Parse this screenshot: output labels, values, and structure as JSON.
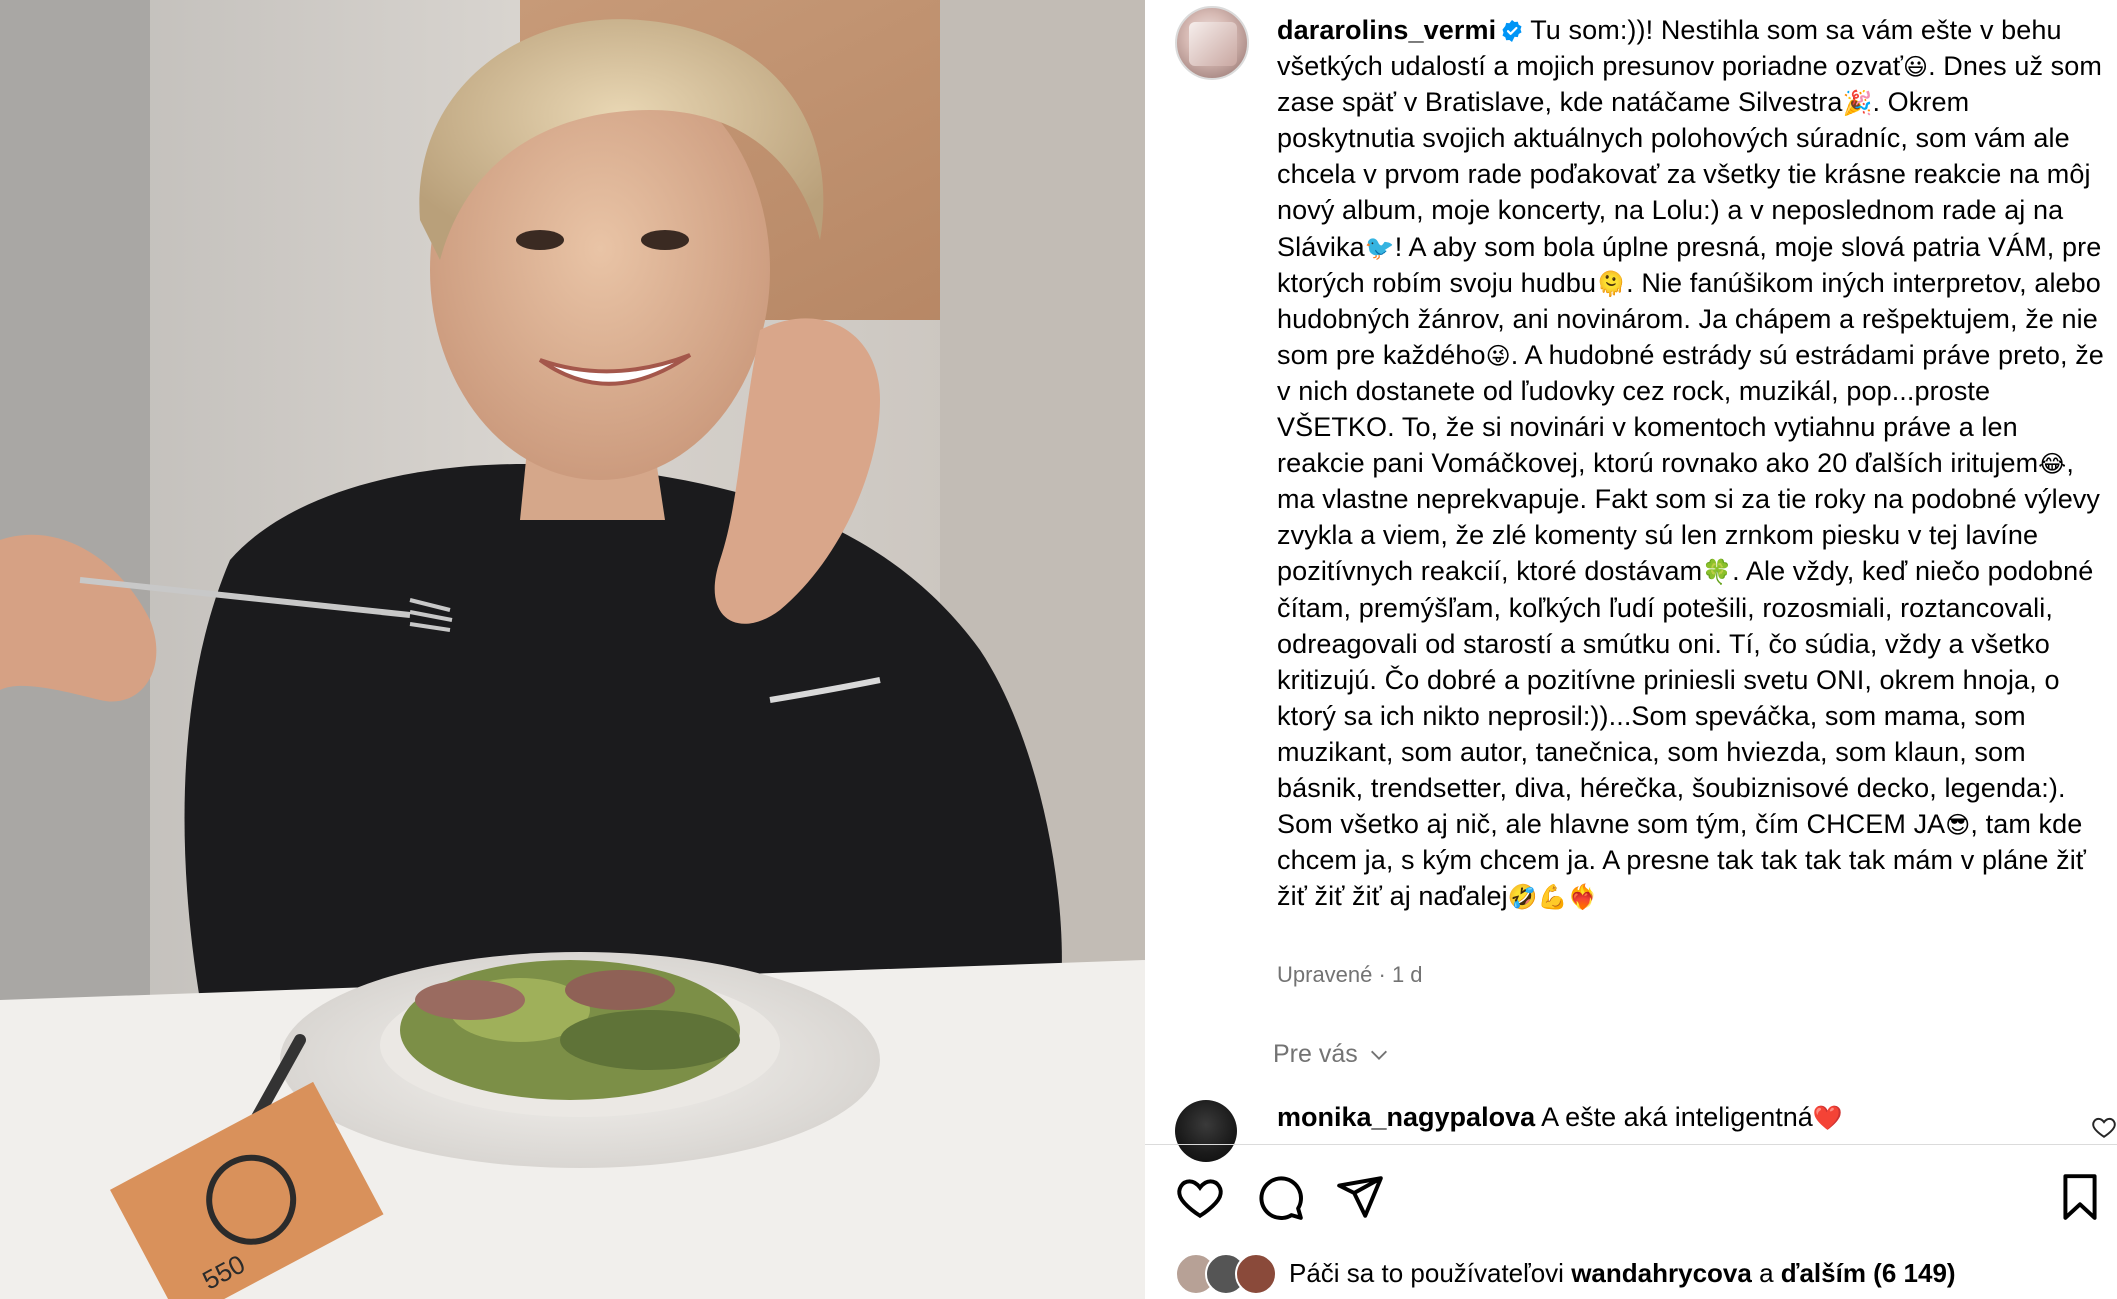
{
  "post": {
    "username": "dararolins_vermi",
    "caption": [
      {
        "t": "Tu som:))! Nestihla som sa vám ešte v behu všetkých udalostí a mojich presunov poriadne ozvať"
      },
      {
        "e": "😃"
      },
      {
        "t": ". Dnes už som zase späť v Bratislave, kde natáčame Silvestra"
      },
      {
        "e": "🎉"
      },
      {
        "t": ". Okrem poskytnutia svojich aktuálnych polohových súradníc, som vám ale chcela v prvom rade poďakovať za všetky tie krásne reakcie na môj nový album, moje koncerty, na Lolu:) a v neposlednom rade aj na Slávika"
      },
      {
        "e": "🐦"
      },
      {
        "t": "! A aby som bola úplne presná, moje slová patria VÁM, pre ktorých robím svoju hudbu"
      },
      {
        "e": "🫠"
      },
      {
        "t": ". Nie fanúšikom iných interpretov, alebo hudobných žánrov, ani novinárom. Ja chápem a rešpektujem, že nie som pre každého"
      },
      {
        "e": "😜"
      },
      {
        "t": ". A hudobné estrády sú estrádami práve preto, že v nich dostanete od ľudovky cez rock, muzikál, pop...proste VŠETKO. To, že si novinári v komentoch vytiahnu práve a len reakcie pani Vomáčkovej, ktorú rovnako ako 20 ďalších iritujem"
      },
      {
        "e": "😂"
      },
      {
        "t": ", ma vlastne neprekvapuje. Fakt som si za tie roky na podobné výlevy zvykla a viem, že zlé komenty sú len zrnkom piesku v tej lavíne pozitívnych reakcií, ktoré dostávam"
      },
      {
        "e": "🍀"
      },
      {
        "t": ". Ale vždy, keď niečo podobné čítam, premýšľam, koľkých ľudí potešili, rozosmiali, roztancovali, odreagovali od starostí a smútku oni. Tí, čo súdia, vždy a všetko kritizujú. Čo dobré a pozitívne priniesli svetu ONI, okrem hnoja, o ktorý sa ich nikto neprosil:))...Som speváčka, som mama, som muzikant, som autor, tanečnica, som hviezda, som klaun, som básnik, trendsetter, diva, hérečka, šoubiznisové decko, legenda:). Som všetko aj nič, ale hlavne som tým, čím CHCEM JA"
      },
      {
        "e": "😎"
      },
      {
        "t": ", tam kde chcem ja, s kým chcem ja. A presne tak tak tak tak mám v pláne žiť žiť žiť žiť aj naďalej"
      },
      {
        "e": "🤣"
      },
      {
        "e": "💪"
      },
      {
        "e": "❤️‍🔥"
      }
    ],
    "meta": "Upravené · 1 d",
    "for_you": "Pre vás"
  },
  "comment": {
    "username": "monika_nagypalova",
    "text": "A ešte aká inteligentná",
    "emoji": "❤️"
  },
  "likes": {
    "prefix": "Páči sa to používateľovi",
    "user": "wandahrycova",
    "and": "a",
    "others": "ďalším (6 149)"
  },
  "photo": {
    "card_text": "550"
  },
  "icons": {
    "verified": "verified-badge-icon",
    "like": "heart-icon",
    "comment": "comment-icon",
    "share": "share-icon",
    "save": "bookmark-icon"
  },
  "colors": {
    "verified": "#0095f6",
    "muted": "#737373",
    "divider": "#dbdbdb"
  }
}
